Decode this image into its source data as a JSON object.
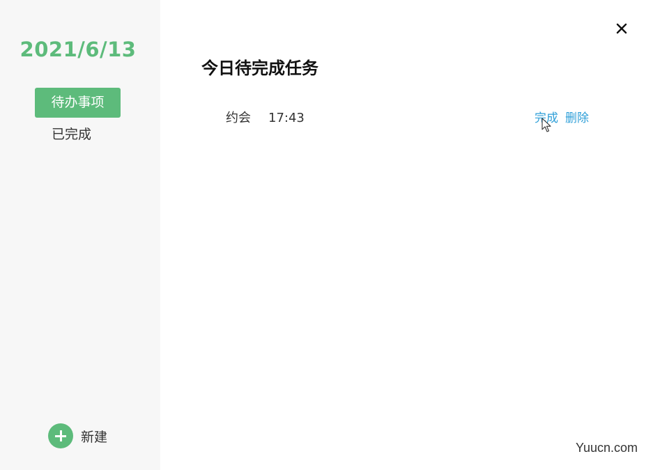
{
  "sidebar": {
    "date": "2021/6/13",
    "nav": [
      {
        "label": "待办事项",
        "active": true
      },
      {
        "label": "已完成",
        "active": false
      }
    ],
    "new_label": "新建"
  },
  "main": {
    "title": "今日待完成任务",
    "tasks": [
      {
        "name": "约会",
        "time": "17:43",
        "done_label": "完成",
        "delete_label": "删除"
      }
    ]
  },
  "icons": {
    "close": "close-icon",
    "add": "plus-icon",
    "cursor": "mouse-pointer-icon"
  },
  "colors": {
    "accent": "#5dbb7b",
    "link": "#2f9fd8",
    "sidebar_bg": "#f7f7f7"
  },
  "watermark": "Yuucn.com"
}
